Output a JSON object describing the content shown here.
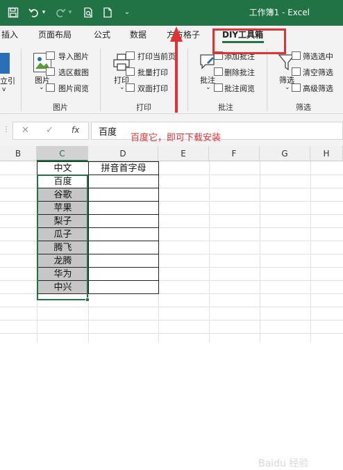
{
  "window": {
    "title": "工作簿1 - Excel",
    "titlebar_icons": [
      "save-icon",
      "undo-icon",
      "redo-icon",
      "print-preview-icon",
      "new-document-icon",
      "customize-dropdown-icon"
    ]
  },
  "ribbon": {
    "tabs": [
      {
        "label": "插入"
      },
      {
        "label": "页面布局"
      },
      {
        "label": "公式"
      },
      {
        "label": "数据"
      },
      {
        "label": "方方格子"
      },
      {
        "label": "DIY工具箱"
      }
    ],
    "active_tab": "DIY工具箱",
    "partial_left": {
      "line1": "立引",
      "line2": "v"
    },
    "groups": {
      "picture": {
        "label": "图片",
        "big_button": "图片",
        "items": [
          "导入图片",
          "选区截图",
          "图片阅览"
        ]
      },
      "print": {
        "label": "打印",
        "big_button": "打印",
        "items": [
          "打印当前页",
          "批量打印",
          "双面打印"
        ]
      },
      "comment": {
        "label": "批注",
        "big_button": "批注",
        "items": [
          "添加批注",
          "删除批注",
          "批注阅览"
        ]
      },
      "filter": {
        "label": "筛选",
        "big_button": "筛选",
        "items": [
          "筛选选中",
          "清空筛选",
          "高级筛选"
        ]
      }
    }
  },
  "formula_bar": {
    "cancel_glyph": "✕",
    "confirm_glyph": "✓",
    "fx_label": "fx",
    "value": "百度"
  },
  "sheet": {
    "columns": [
      "B",
      "C",
      "D",
      "E",
      "F",
      "G",
      "H"
    ],
    "selected_column": "C",
    "header_row": {
      "c": "中文",
      "d": "拼音首字母"
    },
    "rows": [
      "百度",
      "谷歌",
      "苹果",
      "梨子",
      "瓜子",
      "腾飞",
      "龙腾",
      "华为",
      "中兴"
    ]
  },
  "annotation": {
    "text": "百度它，即可下载安装",
    "color": "#e03232"
  },
  "colors": {
    "excel_green": "#217346",
    "ribbon_bg": "#f3f3f3",
    "selection_fill": "#c6c6c6"
  },
  "watermark": "Baidu 经验"
}
